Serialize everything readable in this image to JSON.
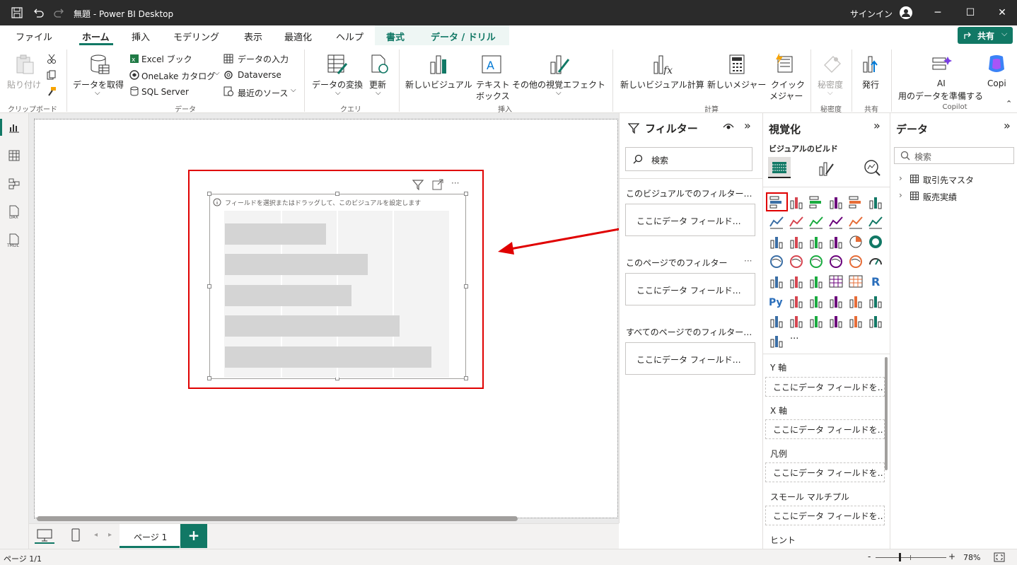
{
  "titlebar": {
    "title": "無題 - Power BI Desktop",
    "signin": "サインイン",
    "minimize": "─",
    "maximize": "☐",
    "close": "✕"
  },
  "tabs": [
    {
      "label": "ファイル"
    },
    {
      "label": "ホーム"
    },
    {
      "label": "挿入"
    },
    {
      "label": "モデリング"
    },
    {
      "label": "表示"
    },
    {
      "label": "最適化"
    },
    {
      "label": "ヘルプ"
    },
    {
      "label": "書式"
    },
    {
      "label": "データ / ドリル"
    }
  ],
  "share_button": "共有",
  "ribbon": {
    "paste": "貼り付け",
    "clipboard_group": "クリップボード",
    "get_data": "データを取得",
    "excel": "Excel ブック",
    "onelake": "OneLake カタログ",
    "sqlserver": "SQL Server",
    "enter_data": "データの入力",
    "dataverse": "Dataverse",
    "recent": "最近のソース",
    "data_group": "データ",
    "transform": "データの変換",
    "refresh": "更新",
    "query_group": "クエリ",
    "new_visual": "新しいビジュアル",
    "textbox_line1": "テキスト",
    "textbox_line2": "ボックス",
    "more_visuals": "その他の視覚エフェクト",
    "insert_group": "挿入",
    "new_visual_calc": "新しいビジュアル計算",
    "new_measure": "新しいメジャー",
    "quick_measure_line1": "クイック",
    "quick_measure_line2": "メジャー",
    "calc_group": "計算",
    "sensitivity": "秘密度",
    "sensitivity_group": "秘密度",
    "publish": "発行",
    "share_group": "共有",
    "ai_line1": "AI",
    "ai_line2": "用のデータを準備する",
    "copilot": "Copi",
    "copilot_group": "Copilot"
  },
  "visual": {
    "hint": "フィールドを選択またはドラッグして、このビジュアルを設定します",
    "more": "···"
  },
  "filters": {
    "title": "フィルター",
    "search_placeholder": "検索",
    "visual_section": "このビジュアルでのフィルター…",
    "page_section": "このページでのフィルター",
    "all_section": "すべてのページでのフィルター…",
    "drop_text": "ここにデータ フィールド…",
    "more": "···"
  },
  "viz": {
    "title": "視覚化",
    "build_label": "ビジュアルのビルド",
    "more": "···",
    "wells": [
      {
        "label": "Y 軸",
        "drop": "ここにデータ フィールドを…"
      },
      {
        "label": "X 軸",
        "drop": "ここにデータ フィールドを…"
      },
      {
        "label": "凡例",
        "drop": "ここにデータ フィールドを…"
      },
      {
        "label": "スモール マルチプル",
        "drop": "ここにデータ フィールドを…"
      },
      {
        "label": "ヒント"
      }
    ]
  },
  "data": {
    "title": "データ",
    "search_placeholder": "検索",
    "tables": [
      {
        "label": "取引先マスタ"
      },
      {
        "label": "販売実績"
      }
    ]
  },
  "bottom": {
    "page_tab": "ページ 1",
    "add": "+"
  },
  "status": {
    "page": "ページ 1/1",
    "zoom": "78%",
    "minus": "-",
    "plus": "+"
  },
  "colors": {
    "accent": "#117865",
    "highlight": "#e00000",
    "titlebar": "#2b2b2b"
  }
}
